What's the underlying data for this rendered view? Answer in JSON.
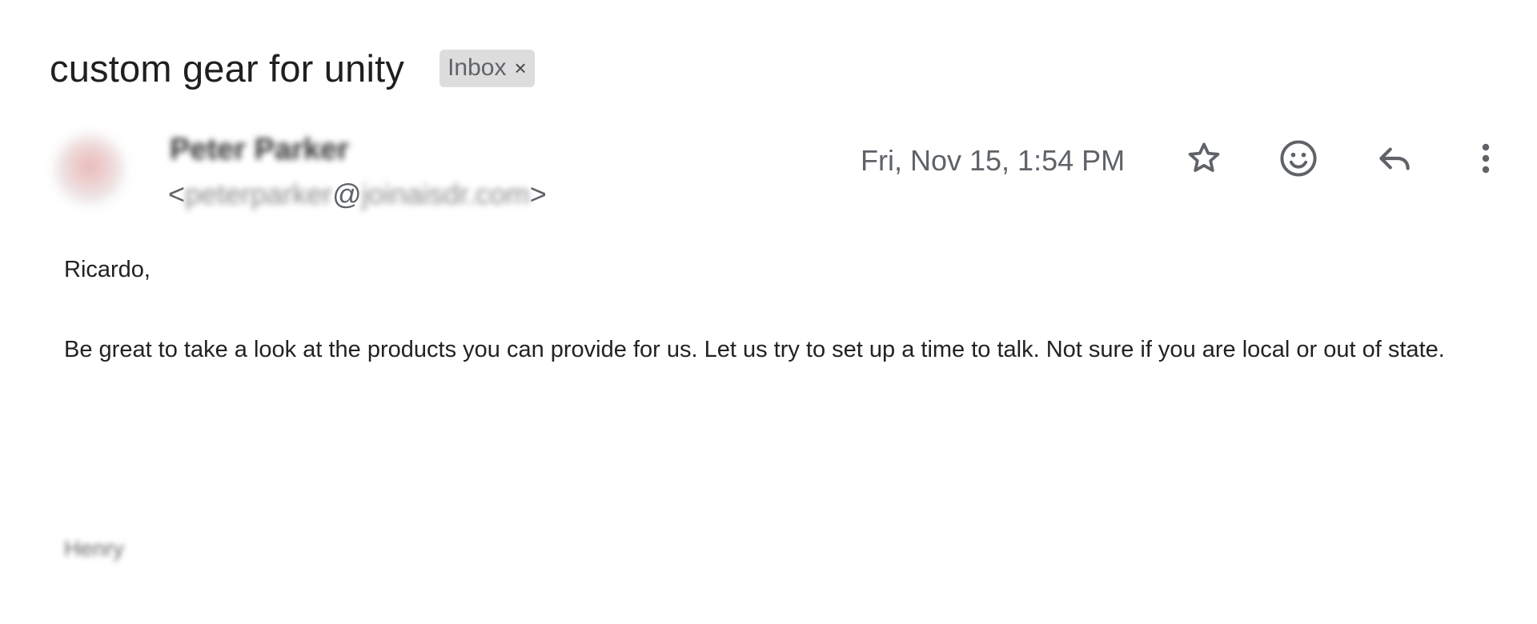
{
  "email": {
    "subject": "custom gear for unity",
    "label": "Inbox",
    "label_close": "×",
    "sender": {
      "name": "Peter Parker",
      "email_open": "<",
      "email_user": "peterparker",
      "email_at": "@",
      "email_domain": "joinaisdr.com",
      "email_close": ">"
    },
    "date": "Fri, Nov 15, 1:54 PM",
    "actions": [
      {
        "name": "star-button",
        "icon": "star-icon"
      },
      {
        "name": "react-button",
        "icon": "smiley-icon"
      },
      {
        "name": "reply-button",
        "icon": "reply-icon"
      },
      {
        "name": "more-button",
        "icon": "more-vert-icon"
      }
    ],
    "body": {
      "greeting": "Ricardo,",
      "paragraph": "Be great to take a look at the products you can provide for us. Let us try to set up a time to talk. Not sure if you are local or out of state.",
      "signature": "Henry"
    }
  },
  "colors": {
    "icon": "#5f6368",
    "chip_bg": "#dddddd"
  }
}
